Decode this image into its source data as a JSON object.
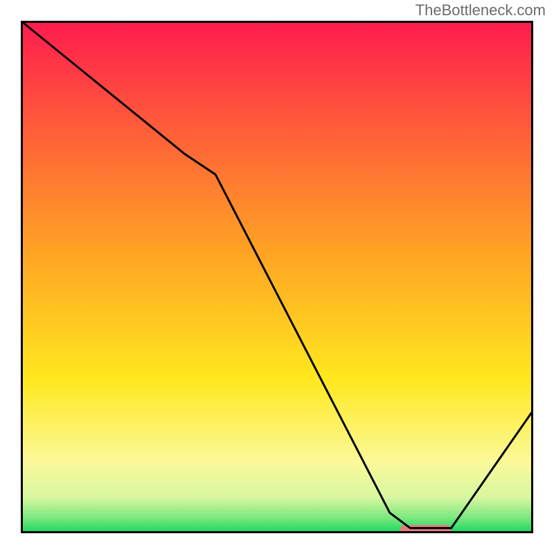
{
  "watermark": "TheBottleneck.com",
  "chart_data": {
    "type": "line",
    "title": "",
    "xlabel": "",
    "ylabel": "",
    "xlim": [
      0,
      100
    ],
    "ylim": [
      0,
      100
    ],
    "grid": false,
    "series": [
      {
        "name": "curve",
        "color": "#000000",
        "x": [
          0,
          32,
          38,
          72,
          76,
          84,
          100
        ],
        "values": [
          100,
          74,
          70,
          4,
          1,
          1,
          24
        ]
      }
    ],
    "marker": {
      "name": "highlight-bar",
      "color": "#e77a7f",
      "x_start": 74,
      "x_end": 84,
      "y": 0.6,
      "thickness": 2.0
    },
    "background_gradient": {
      "stops": [
        {
          "offset": 0.0,
          "color": "#ff1b4f"
        },
        {
          "offset": 0.2,
          "color": "#ff5a3a"
        },
        {
          "offset": 0.45,
          "color": "#ffa324"
        },
        {
          "offset": 0.7,
          "color": "#ffe81e"
        },
        {
          "offset": 0.86,
          "color": "#fbf99a"
        },
        {
          "offset": 0.93,
          "color": "#d8f7a0"
        },
        {
          "offset": 0.97,
          "color": "#7be87e"
        },
        {
          "offset": 1.0,
          "color": "#16d65f"
        }
      ]
    }
  }
}
